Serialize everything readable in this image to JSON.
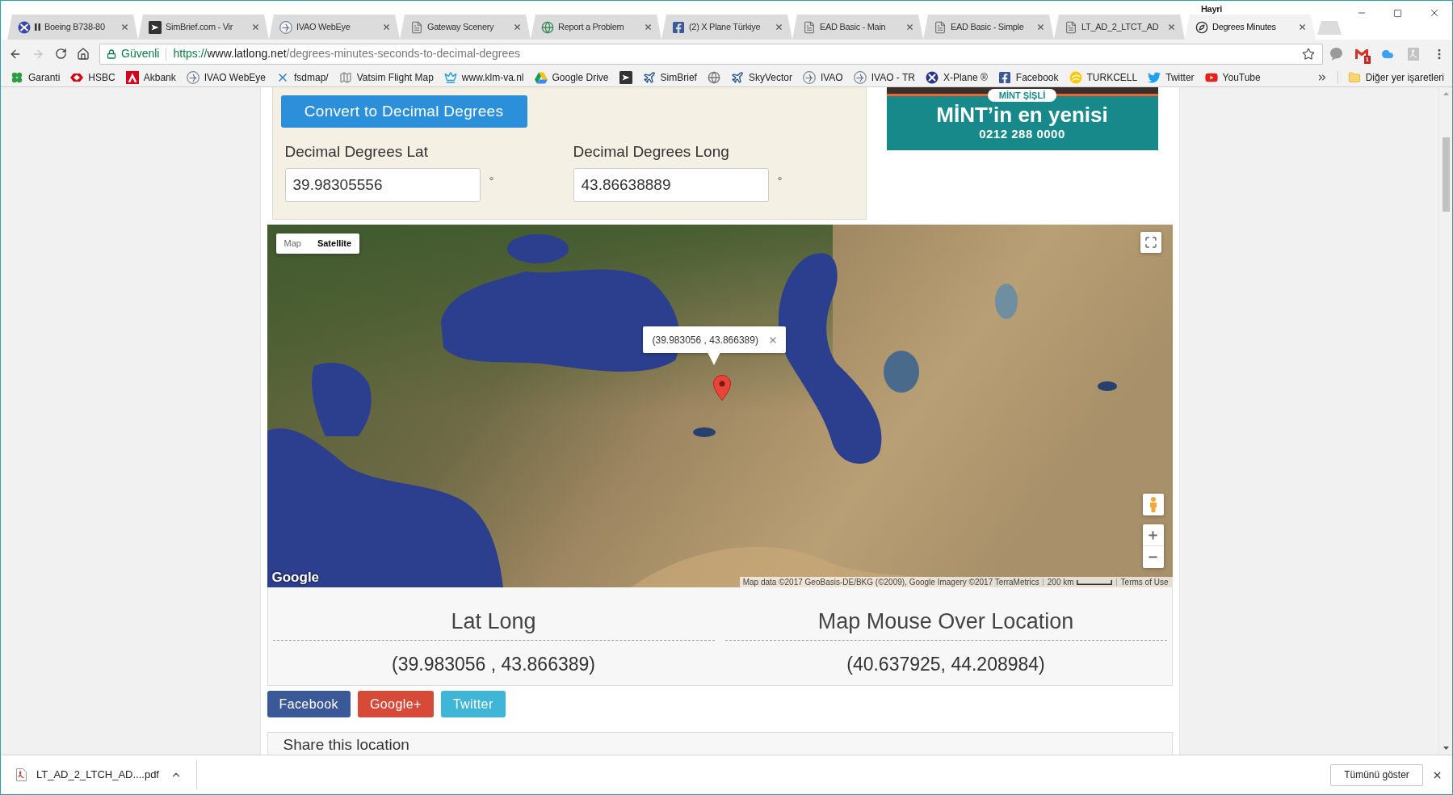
{
  "window": {
    "user": "Hayri"
  },
  "tabs": [
    {
      "title": "Boeing B738-80",
      "paused": true,
      "selected": false
    },
    {
      "title": "SimBrief.com - Vir",
      "paused": false,
      "selected": false
    },
    {
      "title": "IVAO WebEye",
      "paused": false,
      "selected": false
    },
    {
      "title": "Gateway Scenery",
      "paused": false,
      "selected": false
    },
    {
      "title": "Report a Problem",
      "paused": false,
      "selected": false
    },
    {
      "title": "(2) X Plane Türkiye",
      "paused": false,
      "selected": false
    },
    {
      "title": "EAD Basic - Main",
      "paused": false,
      "selected": false
    },
    {
      "title": "EAD Basic - Simple",
      "paused": false,
      "selected": false
    },
    {
      "title": "LT_AD_2_LTCT_AD",
      "paused": false,
      "selected": false
    },
    {
      "title": "Degrees Minutes",
      "paused": false,
      "selected": true
    }
  ],
  "toolbar": {
    "security_label": "Güvenli",
    "url": {
      "scheme": "https://",
      "host": "www.latlong.net",
      "path": "/degrees-minutes-seconds-to-decimal-degrees"
    },
    "mail_badge": "1"
  },
  "bookmarks": [
    {
      "kind": "link",
      "label": "Garanti"
    },
    {
      "kind": "link",
      "label": "HSBC"
    },
    {
      "kind": "link",
      "label": "Akbank"
    },
    {
      "kind": "link",
      "label": "IVAO WebEye"
    },
    {
      "kind": "link",
      "label": "fsdmap/"
    },
    {
      "kind": "link",
      "label": "Vatsim Flight Map"
    },
    {
      "kind": "link",
      "label": "www.klm-va.nl"
    },
    {
      "kind": "link",
      "label": "Google Drive"
    },
    {
      "kind": "icon"
    },
    {
      "kind": "link",
      "label": "SimBrief"
    },
    {
      "kind": "icon"
    },
    {
      "kind": "link",
      "label": "SkyVector"
    },
    {
      "kind": "link",
      "label": "IVAO"
    },
    {
      "kind": "link",
      "label": "IVAO - TR"
    },
    {
      "kind": "link",
      "label": "X-Plane ®"
    },
    {
      "kind": "link",
      "label": "Facebook"
    },
    {
      "kind": "link",
      "label": "TURKCELL"
    },
    {
      "kind": "link",
      "label": "Twitter"
    },
    {
      "kind": "link",
      "label": "YouTube"
    }
  ],
  "other_bookmarks": "Diğer yer işaretleri",
  "converter": {
    "button": "Convert to Decimal Degrees",
    "fields": [
      {
        "label": "Decimal Degrees Lat",
        "value": "39.98305556",
        "unit": "°"
      },
      {
        "label": "Decimal Degrees Long",
        "value": "43.86638889",
        "unit": "°"
      }
    ]
  },
  "ad": {
    "badge": "MİNT ŞİŞLİ",
    "headline": "MİNT’in en yenisi",
    "phone": "0212 288 0000"
  },
  "map": {
    "type_controls": [
      {
        "label": "Map",
        "selected": false
      },
      {
        "label": "Satellite",
        "selected": true
      }
    ],
    "info_window": {
      "text": "(39.983056 , 43.866389)"
    },
    "logo": "Google",
    "attribution": "Map data ©2017 GeoBasis-DE/BKG (©2009), Google Imagery ©2017 TerraMetrics",
    "scale": "200 km",
    "terms": "Terms of Use"
  },
  "results": [
    {
      "heading": "Lat Long",
      "value": "(39.983056 , 43.866389)"
    },
    {
      "heading": "Map Mouse Over Location",
      "value": "(40.637925, 44.208984)"
    }
  ],
  "share_buttons": [
    {
      "label": "Facebook",
      "color": "#3b5998"
    },
    {
      "label": "Google+",
      "color": "#d84a38"
    },
    {
      "label": "Twitter",
      "color": "#3fb6d8"
    }
  ],
  "next_panel": {
    "heading": "Share this location"
  },
  "downloads": {
    "items": [
      {
        "filename": "LT_AD_2_LTCH_AD....pdf"
      }
    ],
    "show_all": "Tümünü göster"
  }
}
